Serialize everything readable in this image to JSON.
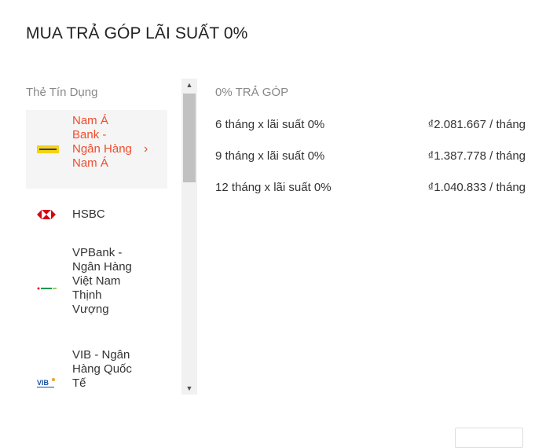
{
  "title": "MUA TRẢ GÓP LÃI SUẤT 0%",
  "sidebar": {
    "section_label": "Thẻ Tín Dụng",
    "banks": [
      {
        "name": "Nam Á Bank - Ngân Hàng Nam Á",
        "logo_text": "NAM A BANK",
        "active": true
      },
      {
        "name": "HSBC",
        "logo_text": "",
        "active": false
      },
      {
        "name": "VPBank - Ngân Hàng Việt Nam Thịnh Vượng",
        "logo_text": "VPBank",
        "active": false
      },
      {
        "name": "VIB - Ngân Hàng Quốc Tế",
        "logo_text": "VIB",
        "active": false
      }
    ]
  },
  "plans": {
    "header": "0% TRẢ GÓP",
    "rows": [
      {
        "term": "6 tháng x lãi suất 0%",
        "amount": "₫2.081.667 / tháng"
      },
      {
        "term": "9 tháng x lãi suất 0%",
        "amount": "₫1.387.778 / tháng"
      },
      {
        "term": "12 tháng x lãi suất 0%",
        "amount": "₫1.040.833 / tháng"
      }
    ]
  },
  "colors": {
    "accent": "#ee4d2d",
    "muted": "#888888",
    "active_bg": "#f5f5f5"
  }
}
